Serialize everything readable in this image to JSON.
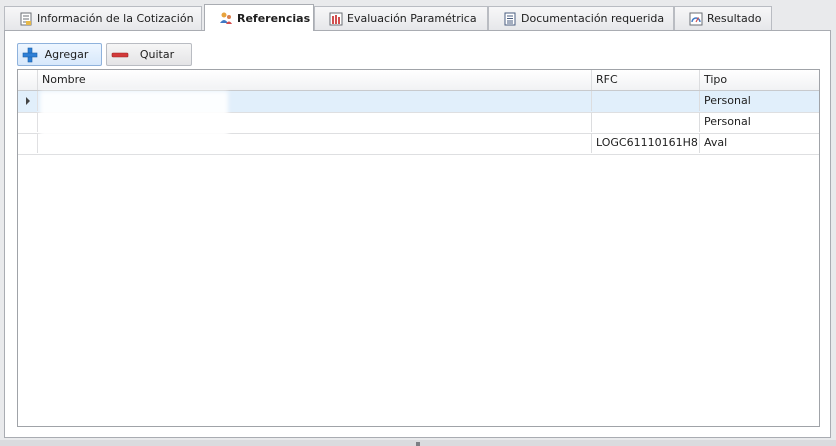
{
  "tabs": [
    {
      "label": "Información de la Cotización",
      "icon": "document-icon"
    },
    {
      "label": "Referencias",
      "icon": "people-icon",
      "active": true
    },
    {
      "label": "Evaluación Paramétrica",
      "icon": "bar-chart-icon"
    },
    {
      "label": "Documentación requerida",
      "icon": "checklist-icon"
    },
    {
      "label": "Resultado",
      "icon": "gauge-icon"
    }
  ],
  "toolbar": {
    "add_label": "Agregar",
    "remove_label": "Quitar"
  },
  "grid": {
    "columns": [
      "Nombre",
      "RFC",
      "Tipo"
    ],
    "rows": [
      {
        "nombre": "",
        "rfc": "",
        "tipo": "Personal",
        "selected": true
      },
      {
        "nombre": "",
        "rfc": "",
        "tipo": "Personal"
      },
      {
        "nombre": "",
        "rfc": "LOGC61110161H8",
        "tipo": "Aval"
      }
    ]
  },
  "colors": {
    "accent": "#1e6fc0",
    "selected_row": "#e1effb",
    "remove_red": "#d23a3a"
  }
}
